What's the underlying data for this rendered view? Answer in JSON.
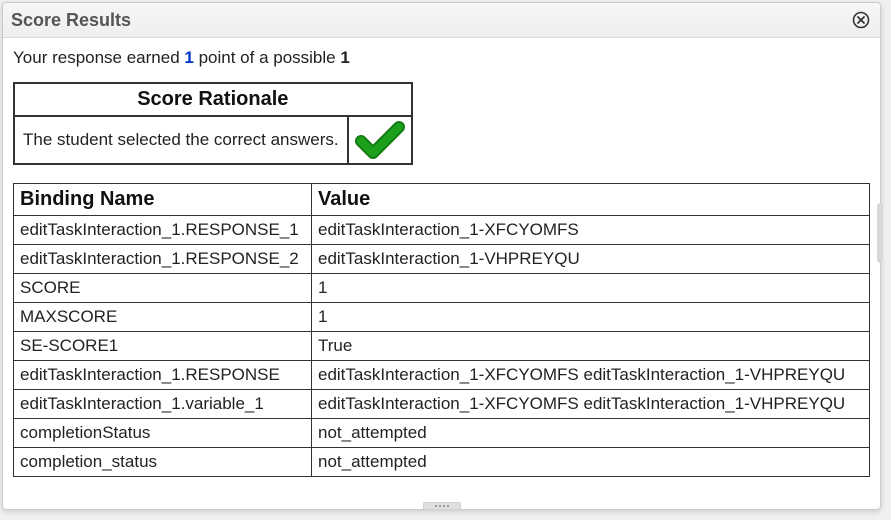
{
  "header": {
    "title": "Score Results"
  },
  "summary": {
    "prefix": "Your response earned ",
    "earned": "1",
    "middle": " point of a possible ",
    "possible": "1"
  },
  "rationale": {
    "header": "Score Rationale",
    "text": "The student selected the correct answers.",
    "icon": "check-correct"
  },
  "bindings": {
    "columns": {
      "name": "Binding Name",
      "value": "Value"
    },
    "rows": [
      {
        "name": "editTaskInteraction_1.RESPONSE_1",
        "value": "editTaskInteraction_1-XFCYOMFS"
      },
      {
        "name": "editTaskInteraction_1.RESPONSE_2",
        "value": "editTaskInteraction_1-VHPREYQU"
      },
      {
        "name": "SCORE",
        "value": "1"
      },
      {
        "name": "MAXSCORE",
        "value": "1"
      },
      {
        "name": "SE-SCORE1",
        "value": "True"
      },
      {
        "name": "editTaskInteraction_1.RESPONSE",
        "value": "editTaskInteraction_1-XFCYOMFS editTaskInteraction_1-VHPREYQU"
      },
      {
        "name": "editTaskInteraction_1.variable_1",
        "value": "editTaskInteraction_1-XFCYOMFS editTaskInteraction_1-VHPREYQU"
      },
      {
        "name": "completionStatus",
        "value": "not_attempted"
      },
      {
        "name": "completion_status",
        "value": "not_attempted"
      }
    ]
  }
}
